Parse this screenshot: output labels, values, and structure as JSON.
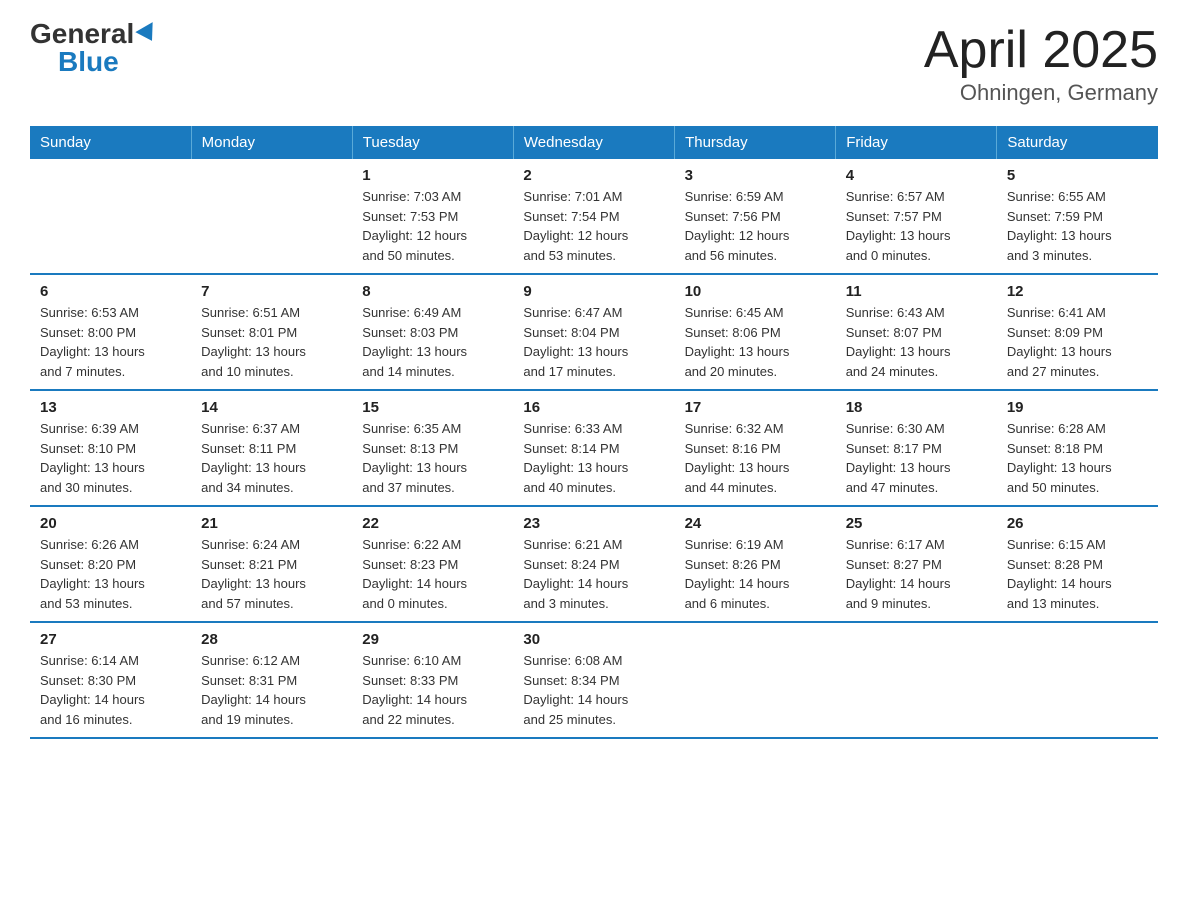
{
  "header": {
    "logo_general": "General",
    "logo_blue": "Blue",
    "title": "April 2025",
    "subtitle": "Ohningen, Germany"
  },
  "days_of_week": [
    "Sunday",
    "Monday",
    "Tuesday",
    "Wednesday",
    "Thursday",
    "Friday",
    "Saturday"
  ],
  "weeks": [
    [
      {
        "day": "",
        "info": ""
      },
      {
        "day": "",
        "info": ""
      },
      {
        "day": "1",
        "info": "Sunrise: 7:03 AM\nSunset: 7:53 PM\nDaylight: 12 hours\nand 50 minutes."
      },
      {
        "day": "2",
        "info": "Sunrise: 7:01 AM\nSunset: 7:54 PM\nDaylight: 12 hours\nand 53 minutes."
      },
      {
        "day": "3",
        "info": "Sunrise: 6:59 AM\nSunset: 7:56 PM\nDaylight: 12 hours\nand 56 minutes."
      },
      {
        "day": "4",
        "info": "Sunrise: 6:57 AM\nSunset: 7:57 PM\nDaylight: 13 hours\nand 0 minutes."
      },
      {
        "day": "5",
        "info": "Sunrise: 6:55 AM\nSunset: 7:59 PM\nDaylight: 13 hours\nand 3 minutes."
      }
    ],
    [
      {
        "day": "6",
        "info": "Sunrise: 6:53 AM\nSunset: 8:00 PM\nDaylight: 13 hours\nand 7 minutes."
      },
      {
        "day": "7",
        "info": "Sunrise: 6:51 AM\nSunset: 8:01 PM\nDaylight: 13 hours\nand 10 minutes."
      },
      {
        "day": "8",
        "info": "Sunrise: 6:49 AM\nSunset: 8:03 PM\nDaylight: 13 hours\nand 14 minutes."
      },
      {
        "day": "9",
        "info": "Sunrise: 6:47 AM\nSunset: 8:04 PM\nDaylight: 13 hours\nand 17 minutes."
      },
      {
        "day": "10",
        "info": "Sunrise: 6:45 AM\nSunset: 8:06 PM\nDaylight: 13 hours\nand 20 minutes."
      },
      {
        "day": "11",
        "info": "Sunrise: 6:43 AM\nSunset: 8:07 PM\nDaylight: 13 hours\nand 24 minutes."
      },
      {
        "day": "12",
        "info": "Sunrise: 6:41 AM\nSunset: 8:09 PM\nDaylight: 13 hours\nand 27 minutes."
      }
    ],
    [
      {
        "day": "13",
        "info": "Sunrise: 6:39 AM\nSunset: 8:10 PM\nDaylight: 13 hours\nand 30 minutes."
      },
      {
        "day": "14",
        "info": "Sunrise: 6:37 AM\nSunset: 8:11 PM\nDaylight: 13 hours\nand 34 minutes."
      },
      {
        "day": "15",
        "info": "Sunrise: 6:35 AM\nSunset: 8:13 PM\nDaylight: 13 hours\nand 37 minutes."
      },
      {
        "day": "16",
        "info": "Sunrise: 6:33 AM\nSunset: 8:14 PM\nDaylight: 13 hours\nand 40 minutes."
      },
      {
        "day": "17",
        "info": "Sunrise: 6:32 AM\nSunset: 8:16 PM\nDaylight: 13 hours\nand 44 minutes."
      },
      {
        "day": "18",
        "info": "Sunrise: 6:30 AM\nSunset: 8:17 PM\nDaylight: 13 hours\nand 47 minutes."
      },
      {
        "day": "19",
        "info": "Sunrise: 6:28 AM\nSunset: 8:18 PM\nDaylight: 13 hours\nand 50 minutes."
      }
    ],
    [
      {
        "day": "20",
        "info": "Sunrise: 6:26 AM\nSunset: 8:20 PM\nDaylight: 13 hours\nand 53 minutes."
      },
      {
        "day": "21",
        "info": "Sunrise: 6:24 AM\nSunset: 8:21 PM\nDaylight: 13 hours\nand 57 minutes."
      },
      {
        "day": "22",
        "info": "Sunrise: 6:22 AM\nSunset: 8:23 PM\nDaylight: 14 hours\nand 0 minutes."
      },
      {
        "day": "23",
        "info": "Sunrise: 6:21 AM\nSunset: 8:24 PM\nDaylight: 14 hours\nand 3 minutes."
      },
      {
        "day": "24",
        "info": "Sunrise: 6:19 AM\nSunset: 8:26 PM\nDaylight: 14 hours\nand 6 minutes."
      },
      {
        "day": "25",
        "info": "Sunrise: 6:17 AM\nSunset: 8:27 PM\nDaylight: 14 hours\nand 9 minutes."
      },
      {
        "day": "26",
        "info": "Sunrise: 6:15 AM\nSunset: 8:28 PM\nDaylight: 14 hours\nand 13 minutes."
      }
    ],
    [
      {
        "day": "27",
        "info": "Sunrise: 6:14 AM\nSunset: 8:30 PM\nDaylight: 14 hours\nand 16 minutes."
      },
      {
        "day": "28",
        "info": "Sunrise: 6:12 AM\nSunset: 8:31 PM\nDaylight: 14 hours\nand 19 minutes."
      },
      {
        "day": "29",
        "info": "Sunrise: 6:10 AM\nSunset: 8:33 PM\nDaylight: 14 hours\nand 22 minutes."
      },
      {
        "day": "30",
        "info": "Sunrise: 6:08 AM\nSunset: 8:34 PM\nDaylight: 14 hours\nand 25 minutes."
      },
      {
        "day": "",
        "info": ""
      },
      {
        "day": "",
        "info": ""
      },
      {
        "day": "",
        "info": ""
      }
    ]
  ]
}
